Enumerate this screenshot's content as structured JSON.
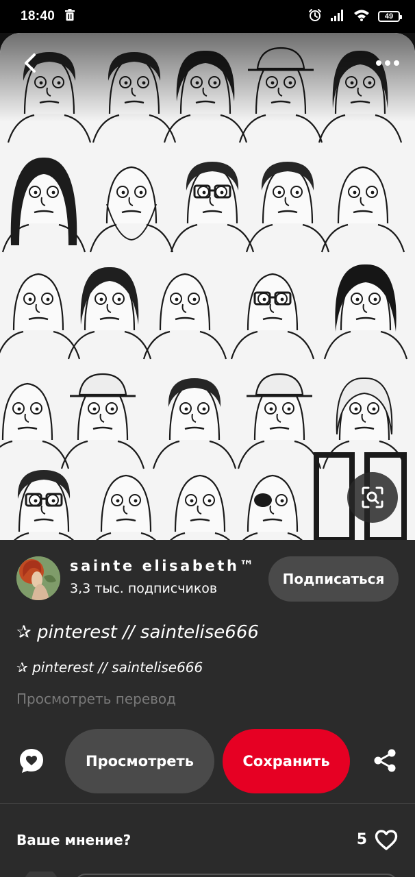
{
  "status_bar": {
    "time": "18:40",
    "battery": "49"
  },
  "pin": {
    "image_alt": "",
    "title": "✰ pinterest // saintelise666",
    "description": "✰ pinterest // saintelise666",
    "translate": "Просмотреть перевод"
  },
  "creator": {
    "name": "sainte elisabeth™",
    "followers": "3,3 тыс. подписчиков",
    "subscribe_label": "Подписаться"
  },
  "actions": {
    "view_label": "Просмотреть",
    "save_label": "Сохранить"
  },
  "feedback": {
    "label": "Ваше мнение?",
    "count": "5"
  },
  "colors": {
    "save": "#e60023",
    "sheet_bg": "#2b2b2b",
    "pill_bg": "#4a4a4a",
    "muted_text": "#7a7a7a"
  },
  "icons": {
    "back": "chevron-left-icon",
    "more": "more-horizontal-icon",
    "visual_search": "visual-search-icon",
    "comment": "comment-heart-icon",
    "share": "share-icon",
    "heart": "heart-outline-icon",
    "status_delete": "trash-icon",
    "status_alarm": "alarm-icon",
    "status_signal": "signal-icon",
    "status_wifi": "wifi-icon"
  }
}
